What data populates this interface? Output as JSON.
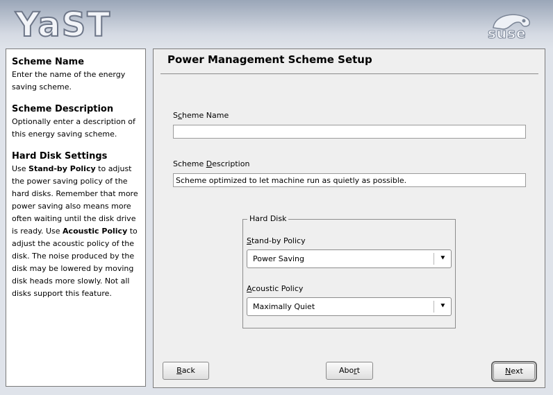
{
  "branding": {
    "product_logo": "YaST",
    "vendor_logo": "suse"
  },
  "help": {
    "sections": [
      {
        "heading": "Scheme Name",
        "text": "Enter the name of the energy saving scheme."
      },
      {
        "heading": "Scheme Description",
        "text": "Optionally enter a description of this energy saving scheme."
      },
      {
        "heading": "Hard Disk Settings",
        "p1": "Use ",
        "b1": "Stand-by Policy",
        "p2": " to adjust the power saving policy of the hard disks. Remember that more power saving also means more often waiting until the disk drive is ready. Use ",
        "b2": "Acoustic Policy",
        "p3": " to adjust the acoustic policy of the disk. The noise produced by the disk may be lowered by moving disk heads more slowly. Not all disks support this feature."
      }
    ]
  },
  "main": {
    "title": "Power Management Scheme Setup",
    "scheme_name": {
      "label_pre": "S",
      "label_key": "c",
      "label_post": "heme Name",
      "value": ""
    },
    "scheme_description": {
      "label_pre": "Scheme ",
      "label_key": "D",
      "label_post": "escription",
      "value": "Scheme optimized to let machine run as quietly as possible."
    },
    "hard_disk": {
      "legend": "Hard Disk",
      "standby": {
        "label_key": "S",
        "label_post": "tand-by Policy",
        "value": "Power Saving"
      },
      "acoustic": {
        "label_key": "A",
        "label_post": "coustic Policy",
        "value": "Maximally Quiet"
      }
    }
  },
  "buttons": {
    "back": {
      "key": "B",
      "rest": "ack"
    },
    "abort": {
      "pre": "Abo",
      "key": "r",
      "rest": "t"
    },
    "next": {
      "key": "N",
      "rest": "ext"
    }
  }
}
